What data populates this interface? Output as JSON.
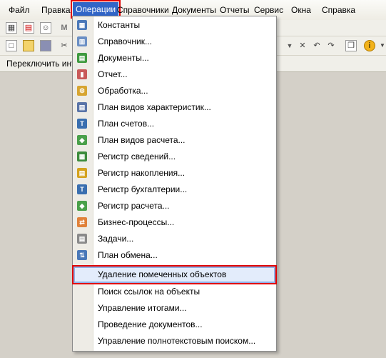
{
  "menubar": [
    {
      "label": "Файл",
      "key": "file"
    },
    {
      "label": "Правка",
      "key": "edit"
    },
    {
      "label": "Операции",
      "key": "operations",
      "active": true
    },
    {
      "label": "Справочники",
      "key": "catalogs"
    },
    {
      "label": "Документы",
      "key": "documents"
    },
    {
      "label": "Отчеты",
      "key": "reports"
    },
    {
      "label": "Сервис",
      "key": "service"
    },
    {
      "label": "Окна",
      "key": "windows"
    },
    {
      "label": "Справка",
      "key": "help"
    }
  ],
  "toolbar": {
    "switch_label": "Переключить инте"
  },
  "dropdown": {
    "items": [
      {
        "label": "Константы",
        "icon": "constants-icon"
      },
      {
        "label": "Справочник...",
        "icon": "catalog-icon"
      },
      {
        "label": "Документы...",
        "icon": "documents-icon"
      },
      {
        "label": "Отчет...",
        "icon": "report-icon"
      },
      {
        "label": "Обработка...",
        "icon": "processing-icon"
      },
      {
        "label": "План видов характеристик...",
        "icon": "characteristic-types-icon"
      },
      {
        "label": "План счетов...",
        "icon": "chart-of-accounts-icon"
      },
      {
        "label": "План видов расчета...",
        "icon": "calculation-types-icon"
      },
      {
        "label": "Регистр сведений...",
        "icon": "information-register-icon"
      },
      {
        "label": "Регистр накопления...",
        "icon": "accumulation-register-icon"
      },
      {
        "label": "Регистр бухгалтерии...",
        "icon": "accounting-register-icon"
      },
      {
        "label": "Регистр расчета...",
        "icon": "calculation-register-icon"
      },
      {
        "label": "Бизнес-процессы...",
        "icon": "business-process-icon"
      },
      {
        "label": "Задачи...",
        "icon": "tasks-icon"
      },
      {
        "label": "План обмена...",
        "icon": "exchange-plan-icon"
      }
    ],
    "items2": [
      {
        "label": "Удаление помеченных объектов",
        "highlighted": true
      },
      {
        "label": "Поиск ссылок на объекты"
      },
      {
        "label": "Управление итогами..."
      },
      {
        "label": "Проведение документов..."
      },
      {
        "label": "Управление полнотекстовым поиском..."
      }
    ]
  },
  "colors": {
    "highlight": "#3165c7",
    "callout_border": "#e10000"
  }
}
